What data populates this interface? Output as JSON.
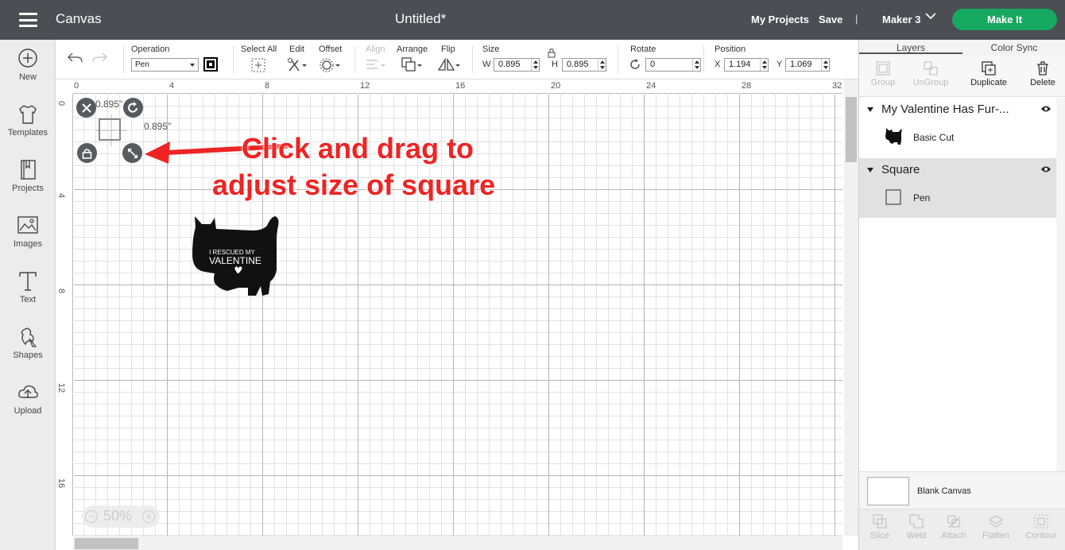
{
  "topbar": {
    "app_title": "Canvas",
    "doc_title": "Untitled*",
    "my_projects": "My Projects",
    "save": "Save",
    "separator": "|",
    "machine": "Maker 3",
    "make_it": "Make It",
    "make_it_color": "#16a861"
  },
  "leftbar": {
    "items": [
      {
        "label": "New",
        "icon": "plus-circle-icon"
      },
      {
        "label": "Templates",
        "icon": "tshirt-icon"
      },
      {
        "label": "Projects",
        "icon": "book-icon"
      },
      {
        "label": "Images",
        "icon": "image-icon"
      },
      {
        "label": "Text",
        "icon": "text-t-icon"
      },
      {
        "label": "Shapes",
        "icon": "shapes-icon"
      },
      {
        "label": "Upload",
        "icon": "upload-cloud-icon"
      }
    ]
  },
  "toolbar": {
    "operation_label": "Operation",
    "operation_value": "Pen",
    "select_all": "Select All",
    "edit": "Edit",
    "offset": "Offset",
    "align": "Align",
    "arrange": "Arrange",
    "flip": "Flip",
    "size": "Size",
    "width_letter": "W",
    "width_value": "0.895",
    "height_letter": "H",
    "height_value": "0.895",
    "rotate": "Rotate",
    "rotate_value": "0",
    "position": "Position",
    "x_letter": "X",
    "x_value": "1.194",
    "y_letter": "Y",
    "y_value": "1.069"
  },
  "canvas": {
    "ruler_top": [
      "0",
      "4",
      "8",
      "12",
      "16",
      "20",
      "24",
      "28",
      "32"
    ],
    "ruler_left": [
      "0",
      "4",
      "8",
      "12",
      "16"
    ],
    "width_label": "0.895\"",
    "height_label": "0.895\"",
    "annotation_line1": "Click and drag to",
    "annotation_line2": "adjust size of square",
    "annotation_color": "#ee2424",
    "cat_text_line1": "I RESCUED MY",
    "cat_text_line2": "VALENTINE",
    "zoom_minus": "−",
    "zoom": "50%",
    "zoom_plus": "+"
  },
  "right_panel": {
    "tabs": [
      "Layers",
      "Color Sync"
    ],
    "tools": [
      {
        "label": "Group",
        "enabled": false
      },
      {
        "label": "UnGroup",
        "enabled": false
      },
      {
        "label": "Duplicate",
        "enabled": true
      },
      {
        "label": "Delete",
        "enabled": true
      }
    ],
    "groups": [
      {
        "name": "My Valentine Has Fur-...",
        "layer": "Basic Cut"
      },
      {
        "name": "Square",
        "layer": "Pen"
      }
    ],
    "blank_canvas": "Blank Canvas",
    "bottom_tools": [
      "Slice",
      "Weld",
      "Attach",
      "Flatten",
      "Contour"
    ]
  }
}
